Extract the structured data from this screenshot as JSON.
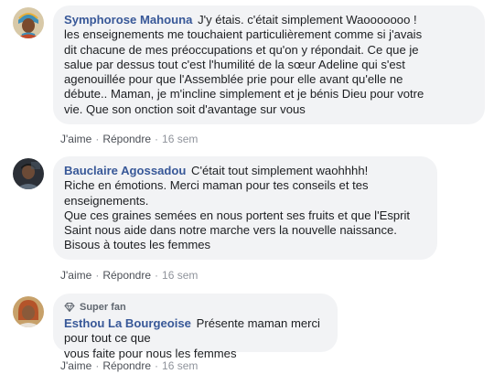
{
  "comments": [
    {
      "author": "Symphorose Mahouna",
      "lines": [
        "J'y étais. c'était simplement Waooooooo !",
        "les enseignements me touchaient particulièrement comme si j'avais",
        "dit chacune de mes préoccupations et qu'on y répondait. Ce que je",
        "salue par dessus tout c'est l'humilité de la sœur Adeline qui s'est",
        "agenouillée pour que l'Assemblée prie pour elle avant qu'elle ne",
        "débute.. Maman, je m'incline simplement et je bénis Dieu pour votre",
        "vie. Que son onction soit d'avantage sur vous"
      ],
      "like_label": "J'aime",
      "reply_label": "Répondre",
      "separator": "·",
      "time": "16 sem"
    },
    {
      "author": "Bauclaire Agossadou",
      "lines": [
        "C'était tout simplement waohhhh!",
        "Riche en émotions. Merci maman pour tes conseils et tes",
        "enseignements.",
        "Que ces graines semées en nous portent ses fruits et que l'Esprit",
        "Saint nous aide dans notre marche vers la nouvelle naissance.",
        "Bisous à toutes les femmes"
      ],
      "like_label": "J'aime",
      "reply_label": "Répondre",
      "separator": "·",
      "time": "16 sem"
    },
    {
      "badge": "Super fan",
      "author": "Esthou La Bourgeoise",
      "lines": [
        "Présente maman merci pour tout ce que",
        "vous faite pour nous les femmes"
      ],
      "like_label": "J'aime",
      "reply_label": "Répondre",
      "separator": "·",
      "time": "16 sem"
    }
  ],
  "colors": {
    "author": "#385898",
    "bubble": "#f2f3f5",
    "meta": "#606770",
    "text": "#1c1e21"
  }
}
